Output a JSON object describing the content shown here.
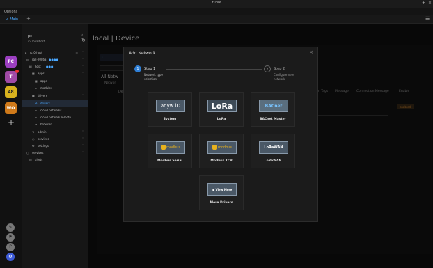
{
  "window": {
    "title": "rubix"
  },
  "menubar": {
    "options_label": "Options"
  },
  "tabs": [
    {
      "label": "Main"
    }
  ],
  "workspaces": [
    "PC",
    "T",
    "48",
    "WO"
  ],
  "tree": {
    "host": "pc",
    "host_sub": "ip: localhost",
    "items": [
      {
        "label": "rc-0-host"
      },
      {
        "label": "rak-2086a"
      },
      {
        "label": "host"
      },
      {
        "label": "apps"
      },
      {
        "label": "apps"
      },
      {
        "label": "modules"
      },
      {
        "label": "drivers"
      },
      {
        "label": "drivers"
      },
      {
        "label": "cloud networks"
      },
      {
        "label": "cloud network remote"
      },
      {
        "label": "browser"
      },
      {
        "label": "admin"
      },
      {
        "label": "services"
      },
      {
        "label": "settings"
      },
      {
        "label": "services"
      },
      {
        "label": "alerts"
      }
    ]
  },
  "page": {
    "title": "local | Device",
    "all_networks": "All Netw",
    "network_sub": "Networ",
    "de_label": "De",
    "columns": [
      "n Tags",
      "Message",
      "Connection Message",
      "Enable"
    ],
    "status_label": "enabled"
  },
  "modal": {
    "title": "Add Network",
    "close": "×",
    "step1_num": "1",
    "step1_title": "Step 1",
    "step1_sub1": "Network type",
    "step1_sub2": "selection",
    "step2_num": "2",
    "step2_title": "Step 2",
    "step2_sub1": "Configure new",
    "step2_sub2": "network",
    "cards": [
      {
        "label": "System",
        "logo": "anyw   iO"
      },
      {
        "label": "LoRa",
        "logo": "LoRa"
      },
      {
        "label": "BACnet Master",
        "logo": "BACnet"
      },
      {
        "label": "Modbus Serial",
        "logo": "modbus"
      },
      {
        "label": "Modbus TCP",
        "logo": "modbus"
      },
      {
        "label": "LoRaWAN",
        "logo": "LoRaWAN"
      },
      {
        "label": "More Drivers",
        "logo": "View More"
      }
    ]
  },
  "colors": {
    "accent": "#2f7fd6",
    "pc": "#9b3fc1",
    "t": "#a04aa6",
    "n48": "#d8b21e",
    "wo": "#d07a1a"
  }
}
